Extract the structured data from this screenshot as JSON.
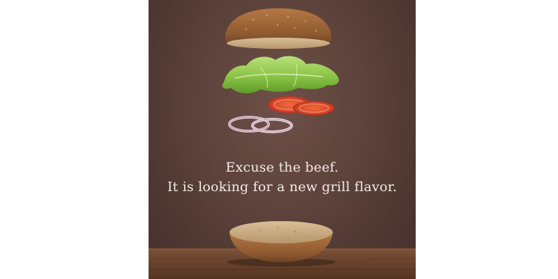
{
  "ad": {
    "headline": "Excuse the beef.",
    "subline": "It is looking for a new grill flavor."
  },
  "colors": {
    "background": "#5c423b",
    "bun": "#a4673a",
    "lettuce": "#7fb83b",
    "tomato": "#d8452a",
    "onion": "#c79ab0",
    "table": "#6d4632",
    "text": "#f3ece6"
  }
}
